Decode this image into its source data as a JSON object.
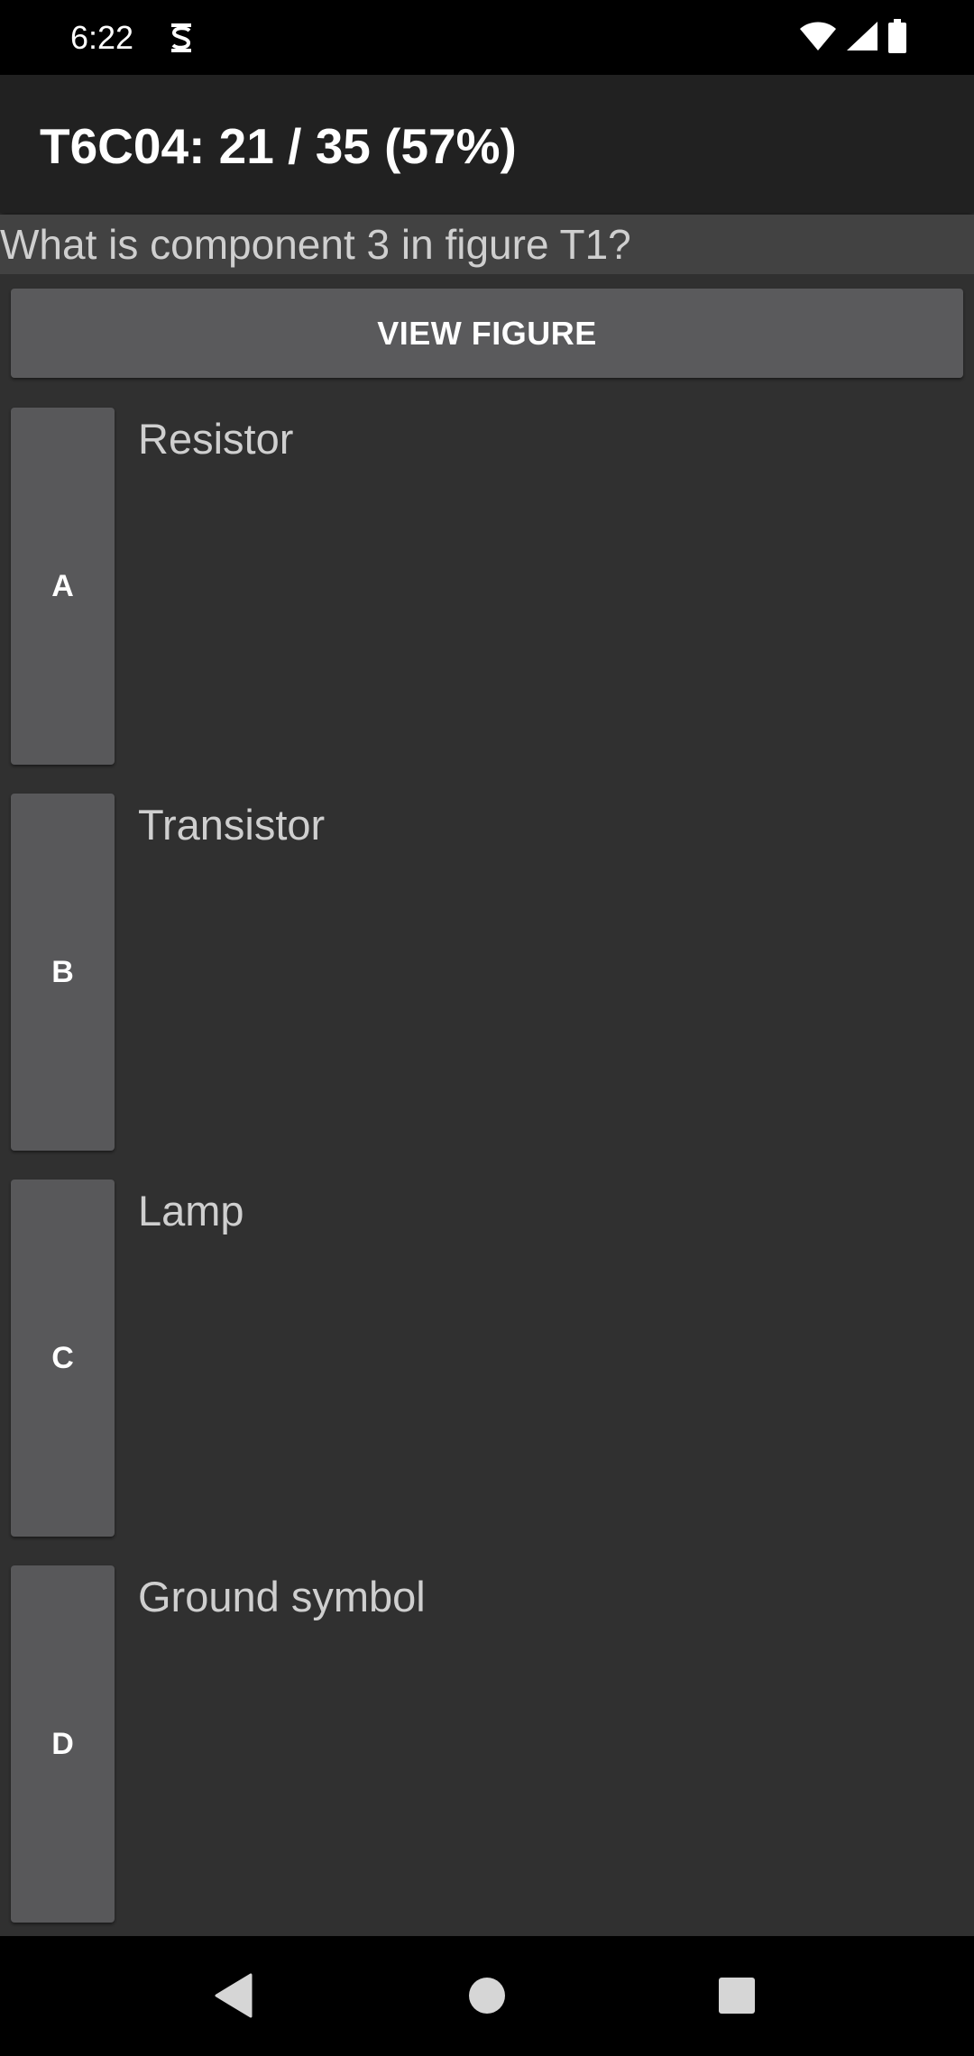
{
  "status_bar": {
    "time": "6:22"
  },
  "header": {
    "title": "T6C04: 21 / 35 (57%)"
  },
  "question": {
    "text": "What is component 3 in figure T1?"
  },
  "view_figure_label": "VIEW FIGURE",
  "answers": [
    {
      "letter": "A",
      "text": "Resistor"
    },
    {
      "letter": "B",
      "text": "Transistor"
    },
    {
      "letter": "C",
      "text": "Lamp"
    },
    {
      "letter": "D",
      "text": "Ground symbol"
    }
  ],
  "icons": {
    "status_app": "s-notification-icon",
    "wifi": "wifi-icon",
    "signal": "cell-signal-icon",
    "battery": "battery-icon",
    "back": "back-triangle-icon",
    "home": "home-circle-icon",
    "recents": "recents-square-icon"
  },
  "colors": {
    "status_bar_bg": "#000000",
    "app_bar_bg": "#212121",
    "question_bg": "#424242",
    "content_bg": "#303030",
    "button_bg": "#58585a",
    "text_primary": "#ffffff",
    "text_secondary": "#cfcfcf"
  }
}
